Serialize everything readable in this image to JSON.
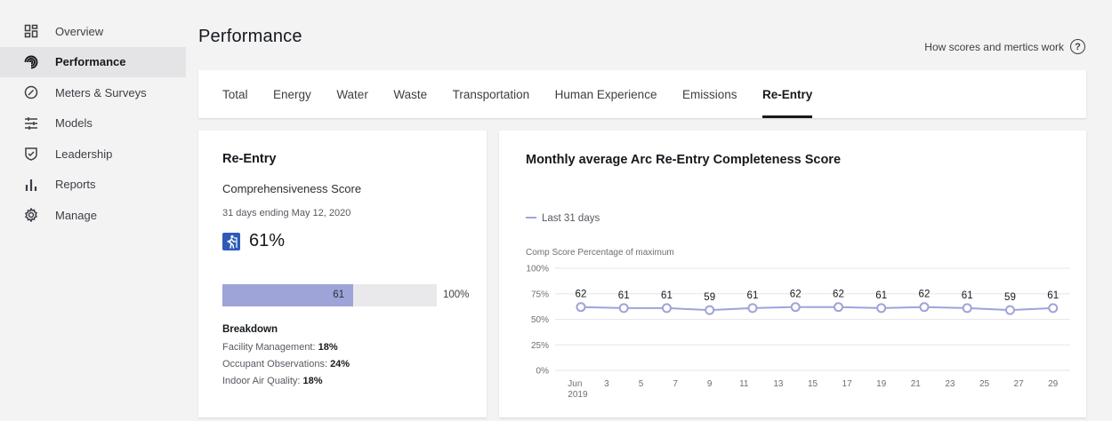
{
  "sidebar": {
    "items": [
      {
        "label": "Overview",
        "icon": "dashboard-grid-icon",
        "active": false
      },
      {
        "label": "Performance",
        "icon": "performance-spiral-icon",
        "active": true
      },
      {
        "label": "Meters & Surveys",
        "icon": "gauge-icon",
        "active": false
      },
      {
        "label": "Models",
        "icon": "sliders-icon",
        "active": false
      },
      {
        "label": "Leadership",
        "icon": "shield-check-icon",
        "active": false
      },
      {
        "label": "Reports",
        "icon": "bar-chart-icon",
        "active": false
      },
      {
        "label": "Manage",
        "icon": "gear-icon",
        "active": false
      }
    ]
  },
  "header": {
    "title": "Performance",
    "help_link": "How scores and mertics work",
    "help_icon": "question-circle-icon"
  },
  "tabs": [
    {
      "label": "Total",
      "active": false
    },
    {
      "label": "Energy",
      "active": false
    },
    {
      "label": "Water",
      "active": false
    },
    {
      "label": "Waste",
      "active": false
    },
    {
      "label": "Transportation",
      "active": false
    },
    {
      "label": "Human Experience",
      "active": false
    },
    {
      "label": "Emissions",
      "active": false
    },
    {
      "label": "Re-Entry",
      "active": true
    }
  ],
  "score_card": {
    "title": "Re-Entry",
    "subtitle": "Comprehensiveness Score",
    "period": "31 days ending May 12, 2020",
    "score_icon": "person-walking-icon",
    "score": "61%",
    "bar_value": 61,
    "bar_label": "61",
    "bar_max_label": "100%",
    "breakdown_title": "Breakdown",
    "breakdown": [
      {
        "label": "Facility Management: ",
        "value": "18%"
      },
      {
        "label": "Occupant Observations: ",
        "value": "24%"
      },
      {
        "label": "Indoor Air Quality: ",
        "value": "18%"
      }
    ],
    "colors": {
      "bar_fill": "#9ea4d8",
      "bar_track": "#e9e9eb",
      "icon_bg": "#2d5bb7"
    }
  },
  "chart_data": {
    "type": "line",
    "title": "Monthly average Arc Re-Entry Completeness Score",
    "ylabel": "Comp Score Percentage of maximum",
    "legend": {
      "label": "Last 31 days",
      "placement": "top-left"
    },
    "ylim": [
      0,
      100
    ],
    "yticks": [
      "0%",
      "25%",
      "50%",
      "75%",
      "100%"
    ],
    "xticks": [
      "Jun\n2019",
      "3",
      "5",
      "7",
      "9",
      "11",
      "13",
      "15",
      "17",
      "19",
      "21",
      "23",
      "25",
      "27",
      "29"
    ],
    "xtick_values": [
      1,
      3,
      5,
      7,
      9,
      11,
      13,
      15,
      17,
      19,
      21,
      23,
      25,
      27,
      29
    ],
    "xlim": [
      0,
      30
    ],
    "series": [
      {
        "name": "Last 31 days",
        "color": "#9ea4d8",
        "x": [
          1.5,
          4,
          6.5,
          9,
          11.5,
          14,
          16.5,
          19,
          21.5,
          24,
          26.5,
          29
        ],
        "values": [
          62,
          61,
          61,
          59,
          61,
          62,
          62,
          61,
          62,
          61,
          59,
          61
        ],
        "labels": [
          "62",
          "61",
          "61",
          "59",
          "61",
          "62",
          "62",
          "61",
          "62",
          "61",
          "59",
          "61"
        ]
      }
    ],
    "grid": true
  }
}
